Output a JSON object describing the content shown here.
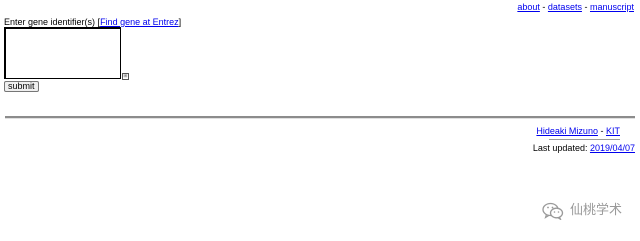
{
  "nav": {
    "about": "about",
    "sep1": "-",
    "datasets": "datasets",
    "sep2": "-",
    "manuscript": "manuscript"
  },
  "form": {
    "label": "Enter gene identifier(s) ",
    "bracket_open": "[",
    "entrez_link": "Find gene at Entrez",
    "bracket_close": "]",
    "textarea_value": "",
    "submit_label": "submit"
  },
  "footer": {
    "author": "Hideaki Mizuno",
    "sep": "-",
    "org": "KIT",
    "updated_label": "Last updated: ",
    "updated_date": "2019/04/07"
  },
  "watermark": {
    "text": "仙桃学术"
  },
  "colors": {
    "link": "#0000ee",
    "rule": "#8c8c8c",
    "watermark": "#9a9a9a"
  }
}
